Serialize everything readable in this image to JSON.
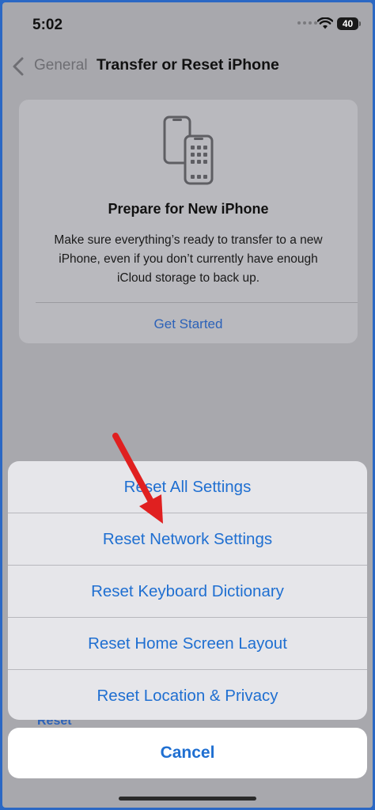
{
  "status_bar": {
    "time": "5:02",
    "battery": "40"
  },
  "nav": {
    "back_label": "General",
    "title": "Transfer or Reset iPhone"
  },
  "prepare_card": {
    "icon": "two-phones-icon",
    "title": "Prepare for New iPhone",
    "description": "Make sure everything’s ready to transfer to a new iPhone, even if you don’t currently have enough iCloud storage to back up.",
    "action": "Get Started"
  },
  "background_peek": "Reset",
  "action_sheet": {
    "items": [
      {
        "label": "Reset All Settings"
      },
      {
        "label": "Reset Network Settings"
      },
      {
        "label": "Reset Keyboard Dictionary"
      },
      {
        "label": "Reset Home Screen Layout"
      },
      {
        "label": "Reset Location & Privacy"
      }
    ],
    "cancel_label": "Cancel"
  },
  "annotation": {
    "arrow_color": "#e02020",
    "points_to": "Reset Network Settings"
  },
  "colors": {
    "accent": "#1f6fd1",
    "frame": "#2b68c4"
  }
}
